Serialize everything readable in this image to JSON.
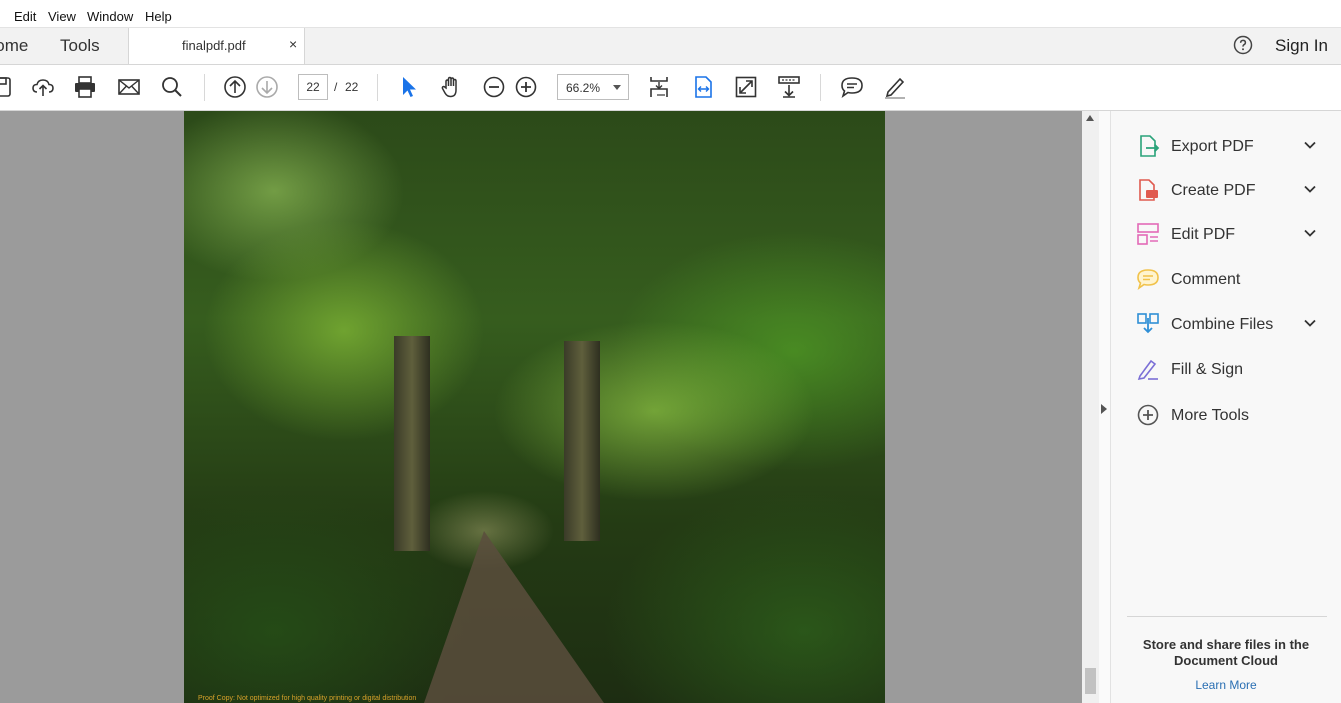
{
  "menu": [
    "Edit",
    "View",
    "Window",
    "Help"
  ],
  "tabs": {
    "home": "Home",
    "tools": "Tools",
    "document": "finalpdf.pdf",
    "close_glyph": "×",
    "sign_in": "Sign In"
  },
  "toolbar": {
    "page_current": "22",
    "page_separator": "/",
    "page_total": "22",
    "zoom": "66.2%",
    "icons": [
      "save-icon",
      "upload-icon",
      "print-icon",
      "email-icon",
      "search-icon",
      "page-up-icon",
      "page-down-icon",
      "select-cursor-icon",
      "hand-icon",
      "zoom-out-icon",
      "zoom-in-icon",
      "fit-page-icon",
      "fit-width-icon",
      "full-screen-icon",
      "scroll-mode-icon",
      "comment-icon",
      "sign-icon"
    ]
  },
  "document": {
    "caption": "Proof Copy: Not optimized for high quality printing or digital distribution"
  },
  "tools_pane": {
    "items": [
      {
        "label": "Export PDF",
        "icon": "export-pdf-icon",
        "expandable": true,
        "color": "#2aa37a"
      },
      {
        "label": "Create PDF",
        "icon": "create-pdf-icon",
        "expandable": true,
        "color": "#e05a4f"
      },
      {
        "label": "Edit PDF",
        "icon": "edit-pdf-icon",
        "expandable": true,
        "color": "#e36ab8"
      },
      {
        "label": "Comment",
        "icon": "comment-tool-icon",
        "expandable": false,
        "color": "#f1c24a"
      },
      {
        "label": "Combine Files",
        "icon": "combine-files-icon",
        "expandable": true,
        "color": "#2f8fd6"
      },
      {
        "label": "Fill & Sign",
        "icon": "fill-sign-icon",
        "expandable": false,
        "color": "#7b6fd6"
      },
      {
        "label": "More Tools",
        "icon": "more-tools-icon",
        "expandable": false,
        "color": "#555555"
      }
    ],
    "cloud_text": "Store and share files in the Document Cloud",
    "learn_more": "Learn More"
  },
  "colors": {
    "accent_blue": "#1a73e8",
    "link": "#2a6fb3",
    "doc_background": "#9b9b9b"
  }
}
